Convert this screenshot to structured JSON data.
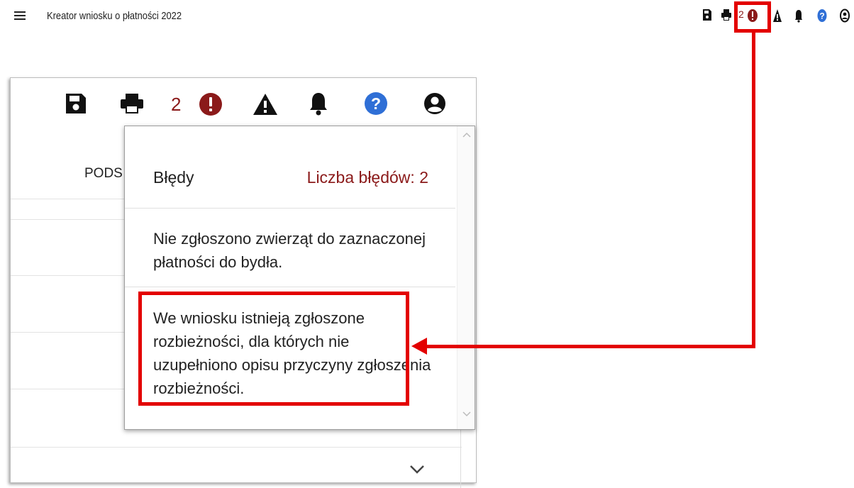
{
  "header": {
    "menu_icon": "hamburger-icon",
    "title": "Kreator wniosku o płatności 2022",
    "error_count": "2",
    "icons": [
      "save-icon",
      "print-icon",
      "error-icon",
      "warning-icon",
      "bell-icon",
      "help-icon",
      "user-icon"
    ]
  },
  "zoom": {
    "error_count": "2",
    "background_tab_label": "PODS"
  },
  "errors_panel": {
    "title": "Błędy",
    "count_label": "Liczba błędów: 2",
    "items": [
      "Nie zgłoszono zwierząt do zaznaczonej płatności do bydła.",
      "We wniosku istnieją zgłoszone rozbieżności, dla których nie uzupełniono opisu przyczyny zgłoszenia rozbieżności."
    ]
  },
  "colors": {
    "error": "#8b1a1a",
    "help": "#2f6fd6",
    "annotation": "#e30000"
  }
}
